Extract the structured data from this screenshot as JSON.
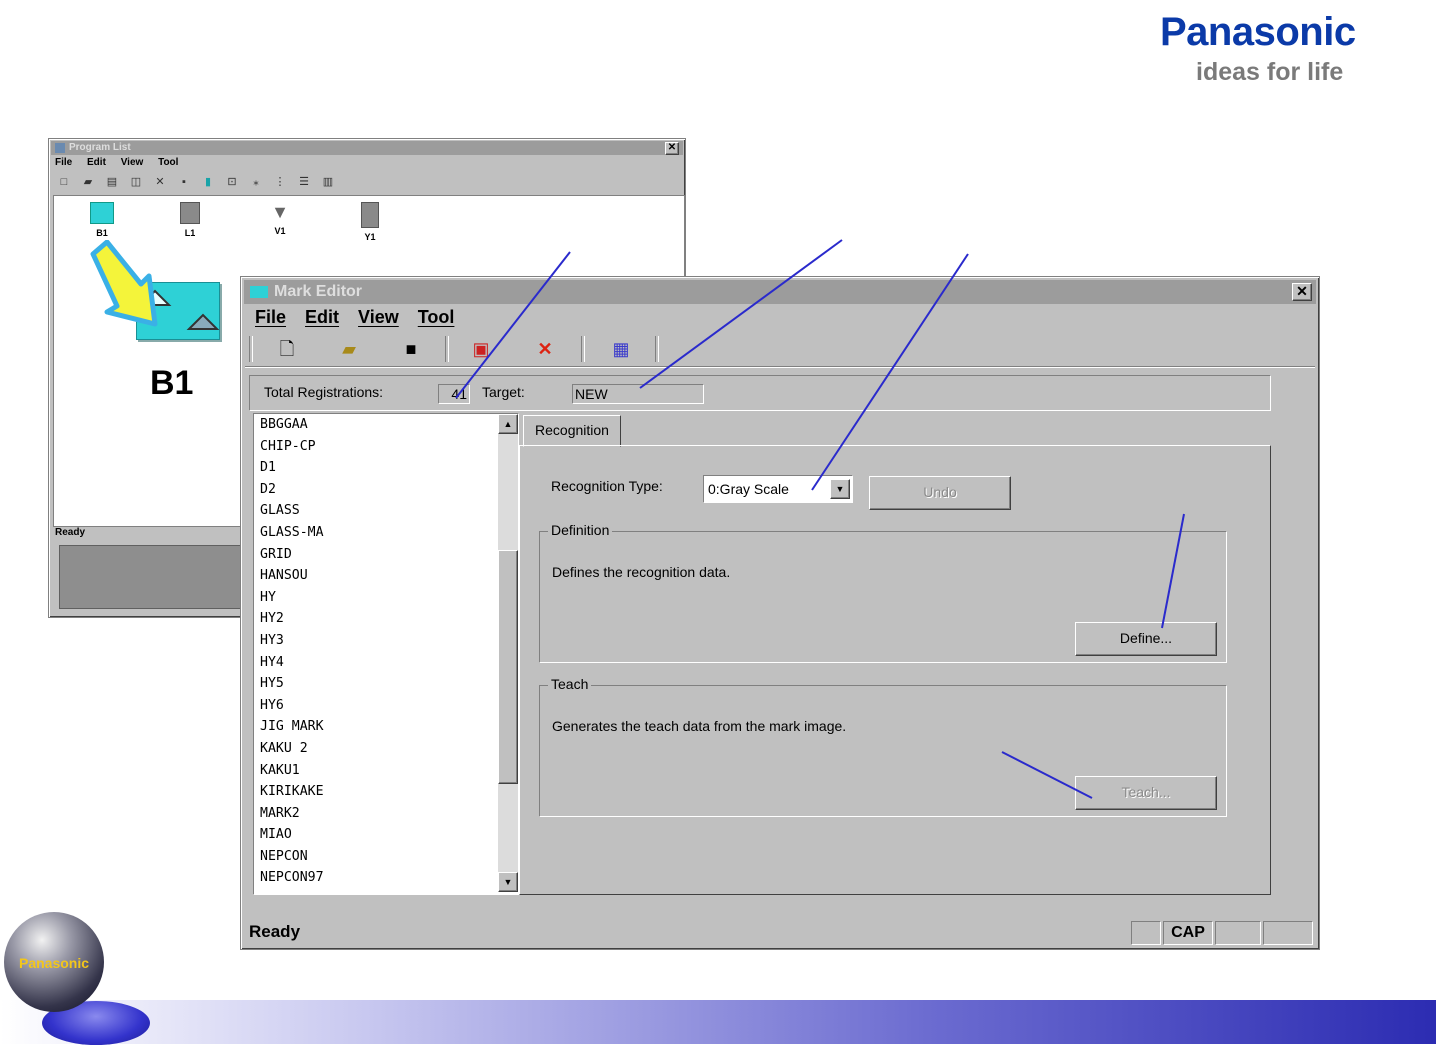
{
  "brand": {
    "name": "Panasonic",
    "tagline": "ideas for life",
    "globe_label": "Panasonic",
    "colors": {
      "brand_blue": "#0b3aa8",
      "globe_text": "#f3c61a",
      "band_end": "#2c2cb2"
    }
  },
  "program_list": {
    "title": "Program List",
    "menu": [
      "File",
      "Edit",
      "View",
      "Tool"
    ],
    "toolbar_icons": [
      "new-icon",
      "open-icon",
      "print-icon",
      "preview-icon",
      "delete-icon",
      "mark-icon",
      "database-icon",
      "refresh-icon",
      "large-icons-icon",
      "small-icons-icon",
      "list-icon",
      "details-icon"
    ],
    "programs": [
      {
        "label": "B1",
        "icon": "board-icon"
      },
      {
        "label": "L1",
        "icon": "library-icon"
      },
      {
        "label": "V1",
        "icon": "vision-icon"
      },
      {
        "label": "Y1",
        "icon": "table-icon"
      }
    ],
    "selected_label": "B1",
    "status": "Ready"
  },
  "mark_editor": {
    "title": "Mark Editor",
    "menu": [
      "File",
      "Edit",
      "View",
      "Tool"
    ],
    "toolbar_icons": [
      "new-icon",
      "open-icon",
      "save-icon",
      "register-icon",
      "delete-icon",
      "teach-icon"
    ],
    "total_registrations_label": "Total Registrations:",
    "total_registrations_value": "41",
    "target_label": "Target:",
    "target_value": "NEW",
    "marks": [
      "BBGGAA",
      "CHIP-CP",
      "D1",
      "D2",
      "GLASS",
      "GLASS-MA",
      "GRID",
      "HANSOU",
      "HY",
      "HY2",
      "HY3",
      "HY4",
      "HY5",
      "HY6",
      "JIG MARK",
      "KAKU 2",
      "KAKU1",
      "KIRIKAKE",
      "MARK2",
      "MIAO",
      "NEPCON",
      "NEPCON97"
    ],
    "tab": "Recognition",
    "recognition_type_label": "Recognition Type:",
    "recognition_type_value": "0:Gray Scale",
    "undo_label": "Undo",
    "definition": {
      "title": "Definition",
      "description": "Defines the recognition data.",
      "button": "Define..."
    },
    "teach": {
      "title": "Teach",
      "description": "Generates the teach data from the mark image.",
      "button": "Teach..."
    },
    "status": "Ready",
    "status_cap": "CAP"
  }
}
